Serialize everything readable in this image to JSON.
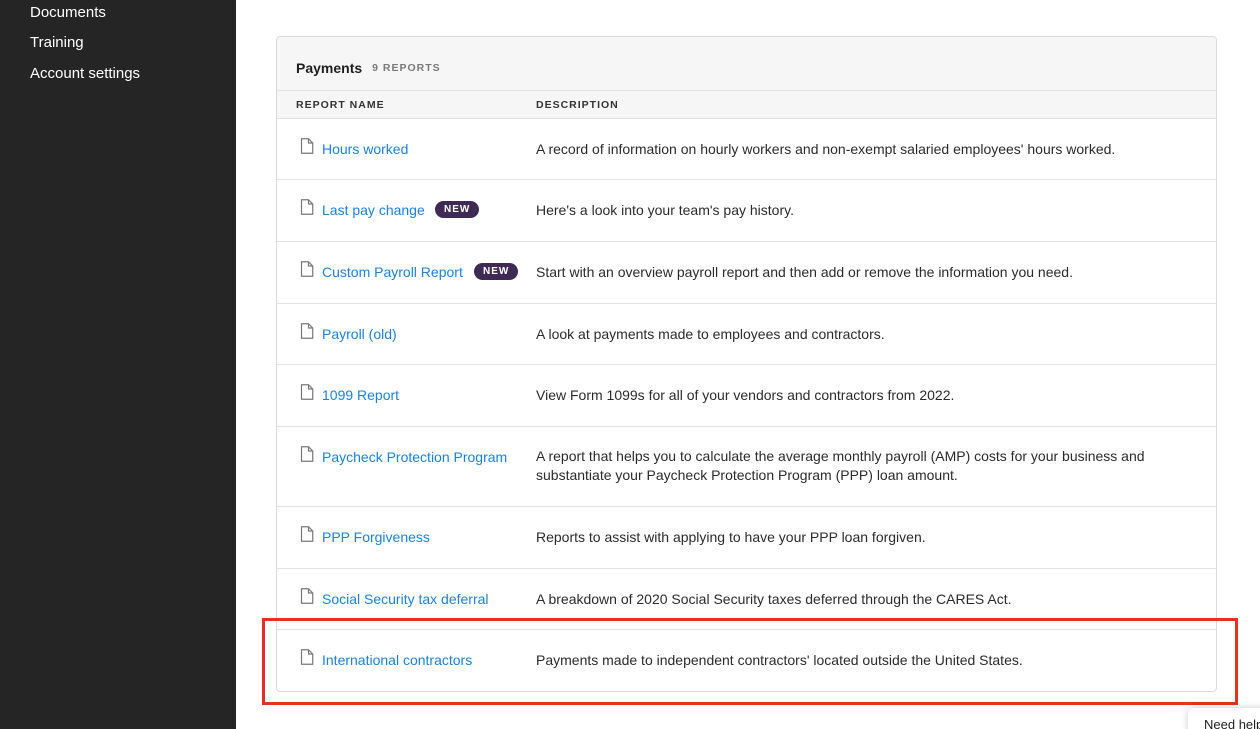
{
  "sidebar": {
    "items": [
      {
        "label": "Documents"
      },
      {
        "label": "Training"
      },
      {
        "label": "Account settings"
      }
    ]
  },
  "card": {
    "title": "Payments",
    "count": "9 REPORTS",
    "columns": {
      "name": "REPORT NAME",
      "description": "DESCRIPTION"
    },
    "badge_label": "NEW",
    "rows": [
      {
        "name": "Hours worked",
        "description": "A record of information on hourly workers and non-exempt salaried employees' hours worked."
      },
      {
        "name": "Last pay change",
        "description": "Here's a look into your team's pay history.",
        "badge": "NEW"
      },
      {
        "name": "Custom Payroll Report",
        "description": "Start with an overview payroll report and then add or remove the information you need.",
        "badge": "NEW"
      },
      {
        "name": "Payroll (old)",
        "description": "A look at payments made to employees and contractors."
      },
      {
        "name": "1099 Report",
        "description": "View Form 1099s for all of your vendors and contractors from 2022."
      },
      {
        "name": "Paycheck Protection Program",
        "description": "A report that helps you to calculate the average monthly payroll (AMP) costs for your business and substantiate your Paycheck Protection Program (PPP) loan amount."
      },
      {
        "name": "PPP Forgiveness",
        "description": "Reports to assist with applying to have your PPP loan forgiven."
      },
      {
        "name": "Social Security tax deferral",
        "description": "A breakdown of 2020 Social Security taxes deferred through the CARES Act."
      },
      {
        "name": "International contractors",
        "description": "Payments made to independent contractors' located outside the United States."
      }
    ]
  },
  "help": {
    "label": "Need help?"
  },
  "colors": {
    "sidebar_bg": "#252525",
    "link": "#1a82e2",
    "badge": "#3f2a56",
    "highlight": "#e8321c"
  }
}
